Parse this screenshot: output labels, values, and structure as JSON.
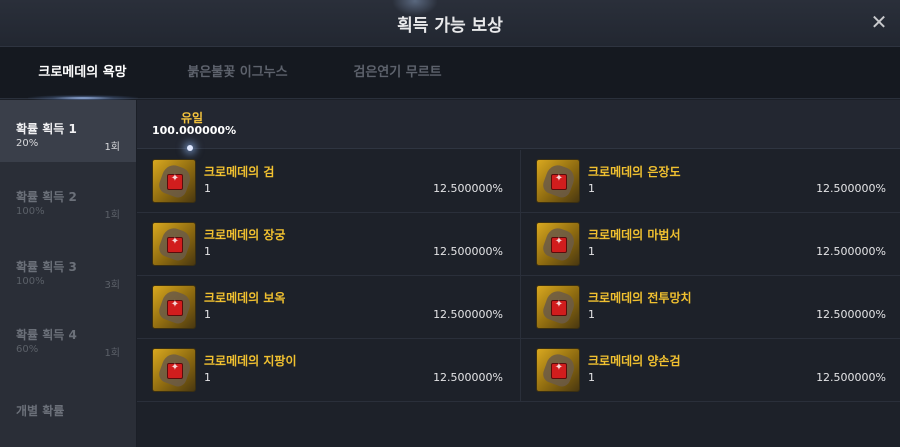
{
  "window": {
    "title": "획득 가능 보상"
  },
  "tabs": [
    {
      "label": "크로메데의 욕망",
      "active": true
    },
    {
      "label": "붉은불꽃 이그누스",
      "active": false
    },
    {
      "label": "검은연기 무르트",
      "active": false
    }
  ],
  "sidebar": {
    "items": [
      {
        "label": "확률 획득 1",
        "percent": "20%",
        "count": "1회",
        "active": true
      },
      {
        "label": "확률 획득 2",
        "percent": "100%",
        "count": "1회",
        "active": false
      },
      {
        "label": "확률 획득 3",
        "percent": "100%",
        "count": "3회",
        "active": false
      },
      {
        "label": "확률 획득 4",
        "percent": "60%",
        "count": "1회",
        "active": false
      }
    ],
    "footer": "개별 확률"
  },
  "grade": {
    "label": "유일",
    "percent": "100.000000%"
  },
  "rewards": [
    {
      "name": "크로메데의 검",
      "qty": "1",
      "percent": "12.500000%",
      "icon": "sword-icon"
    },
    {
      "name": "크로메데의 은장도",
      "qty": "1",
      "percent": "12.500000%",
      "icon": "dagger-icon"
    },
    {
      "name": "크로메데의 장궁",
      "qty": "1",
      "percent": "12.500000%",
      "icon": "bow-icon"
    },
    {
      "name": "크로메데의 마법서",
      "qty": "1",
      "percent": "12.500000%",
      "icon": "spellbook-icon"
    },
    {
      "name": "크로메데의 보옥",
      "qty": "1",
      "percent": "12.500000%",
      "icon": "orb-icon"
    },
    {
      "name": "크로메데의 전투망치",
      "qty": "1",
      "percent": "12.500000%",
      "icon": "warhammer-icon"
    },
    {
      "name": "크로메데의 지팡이",
      "qty": "1",
      "percent": "12.500000%",
      "icon": "staff-icon"
    },
    {
      "name": "크로메데의 양손검",
      "qty": "1",
      "percent": "12.500000%",
      "icon": "greatsword-icon"
    }
  ],
  "colors": {
    "accent": "#f0c030",
    "grade": "#f2c23d",
    "seal": "#d11d1d"
  }
}
